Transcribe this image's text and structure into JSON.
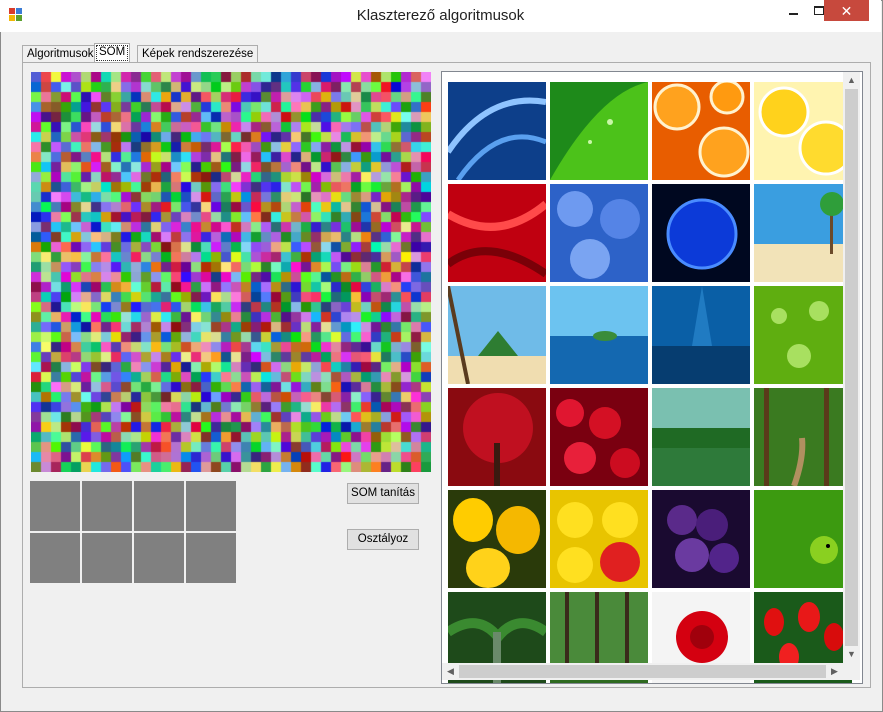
{
  "window": {
    "title": "Klaszterező algoritmusok",
    "close_glyph": "✕"
  },
  "tabs": [
    {
      "label": "Algoritmusok"
    },
    {
      "label": "SOM"
    },
    {
      "label": "Képek rendszerezése"
    }
  ],
  "som_map": {
    "grid_size": 40
  },
  "cluster_grid": {
    "rows": 2,
    "cols": 4,
    "cell_color": "#808080"
  },
  "buttons": {
    "train": "SOM tanítás",
    "classify": "Osztályoz"
  },
  "gallery": {
    "images": [
      {
        "icon": "blue-glass-swirl"
      },
      {
        "icon": "green-leaf-drops"
      },
      {
        "icon": "orange-slices"
      },
      {
        "icon": "lemon-slices"
      },
      {
        "icon": "red-silk"
      },
      {
        "icon": "blue-flowers"
      },
      {
        "icon": "blue-planet"
      },
      {
        "icon": "tropical-beach"
      },
      {
        "icon": "palm-island"
      },
      {
        "icon": "ocean-island"
      },
      {
        "icon": "underwater-blue"
      },
      {
        "icon": "green-water-drops"
      },
      {
        "icon": "red-autumn-tree"
      },
      {
        "icon": "raspberries"
      },
      {
        "icon": "green-lake"
      },
      {
        "icon": "forest-path"
      },
      {
        "icon": "yellow-peppers"
      },
      {
        "icon": "smiley-balls"
      },
      {
        "icon": "grapes"
      },
      {
        "icon": "green-parrot"
      },
      {
        "icon": "jungle"
      },
      {
        "icon": "green-forest"
      },
      {
        "icon": "red-rose"
      },
      {
        "icon": "red-tulips"
      }
    ]
  },
  "scrollbars": {
    "up": "▲",
    "down": "▼",
    "left": "◀",
    "right": "▶"
  }
}
